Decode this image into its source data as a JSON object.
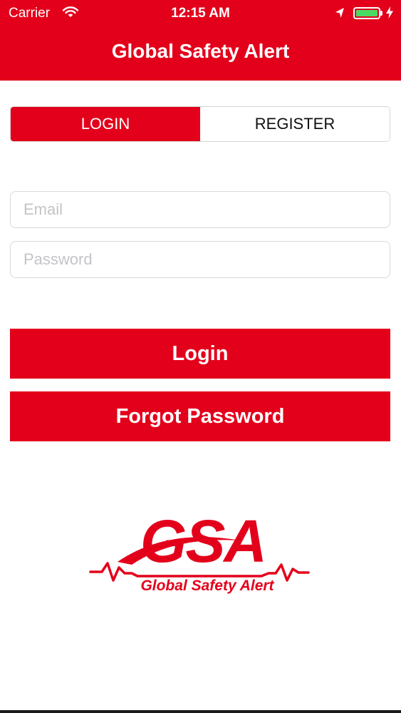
{
  "status_bar": {
    "carrier": "Carrier",
    "time": "12:15 AM",
    "icons": [
      "wifi-icon",
      "location-arrow-icon",
      "battery-icon",
      "charging-bolt-icon"
    ]
  },
  "header": {
    "title": "Global Safety Alert"
  },
  "segmented": {
    "login_label": "LOGIN",
    "register_label": "REGISTER",
    "selected": "LOGIN"
  },
  "form": {
    "email_value": "",
    "email_placeholder": "Email",
    "password_value": "",
    "password_placeholder": "Password"
  },
  "buttons": {
    "login_label": "Login",
    "forgot_label": "Forgot Password"
  },
  "logo": {
    "monogram": "GSA",
    "tagline": "Global Safety Alert"
  },
  "colors": {
    "brand_red": "#e3001b",
    "battery_green": "#4cd964",
    "placeholder_gray": "#c4c4c8"
  }
}
